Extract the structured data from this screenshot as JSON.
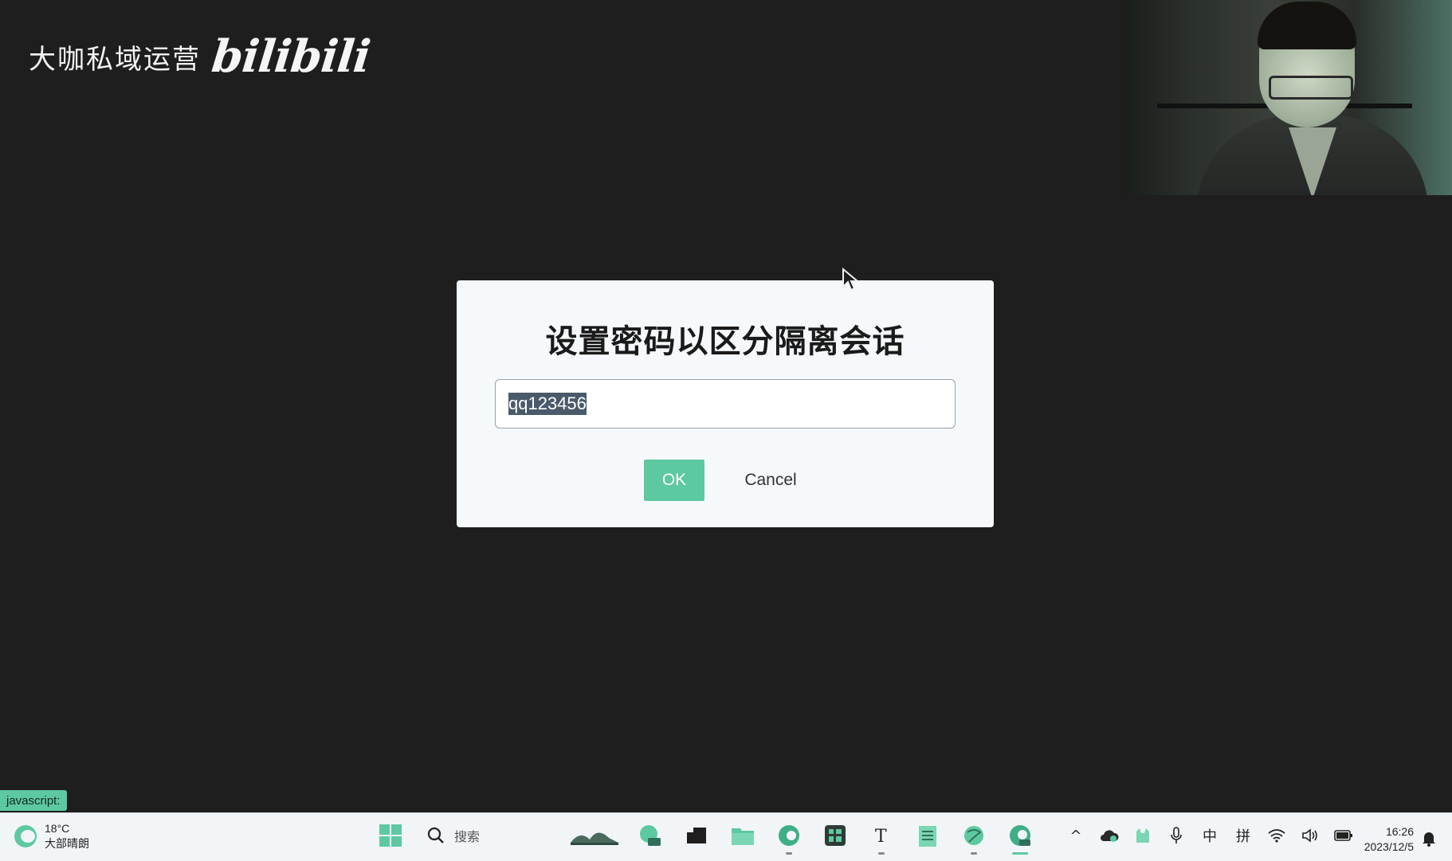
{
  "watermark": {
    "text": "大咖私域运营",
    "logo": "bilibili"
  },
  "dialog": {
    "title": "设置密码以区分隔离会话",
    "password_value": "qq123456",
    "ok_label": "OK",
    "cancel_label": "Cancel"
  },
  "status_tip": "javascript:",
  "taskbar": {
    "weather": {
      "temp": "18°C",
      "condition": "大部晴朗"
    },
    "search_label": "搜索",
    "apps": [
      "start-icon",
      "photos-icon",
      "pre-app-icon",
      "terminal-icon",
      "file-explorer-icon",
      "edge-icon",
      "calculator-icon",
      "typora-icon",
      "notepad-icon",
      "browser-icon",
      "edge-dev-icon"
    ],
    "tray": {
      "chevron": "^",
      "ime_mode": "中",
      "ime_layout": "拼"
    },
    "clock": {
      "time": "16:26",
      "date": "2023/12/5"
    }
  },
  "colors": {
    "accent": "#5dc9a0",
    "background": "#1e1e1e",
    "dialog_bg": "#f5f9fb"
  }
}
